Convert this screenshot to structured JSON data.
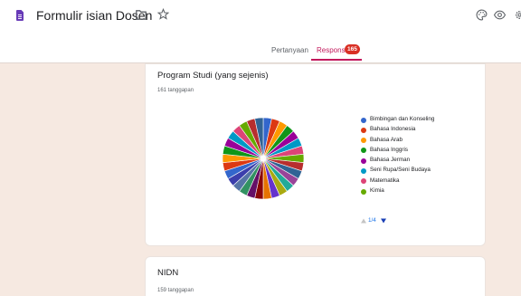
{
  "header": {
    "title": "Formulir isian Dosen"
  },
  "tabs": {
    "questions_label": "Pertanyaan",
    "responses_label": "Respons",
    "responses_count": "165"
  },
  "cards": [
    {
      "title": "Program Studi (yang sejenis)",
      "response_count": "161 tanggapan",
      "chart_data": {
        "type": "pie",
        "legend_position": "right",
        "categories": [
          "Bimbingan dan Konseling",
          "Bahasa Indonesia",
          "Bahasa Arab",
          "Bahasa Inggris",
          "Bahasa Jerman",
          "Seni Rupa/Seni Budaya",
          "Matematika",
          "Kimia"
        ],
        "colors": [
          "#3366cc",
          "#dc3912",
          "#ff9900",
          "#109618",
          "#990099",
          "#0099c6",
          "#dd4477",
          "#66aa00",
          "#b82e2e",
          "#316395",
          "#994499",
          "#22aa99",
          "#aaaa11",
          "#6633cc",
          "#e67300",
          "#8b0707",
          "#651067",
          "#329262",
          "#5574a6",
          "#3b3eac"
        ],
        "slices": 30,
        "pager": "1/4"
      }
    },
    {
      "title": "NIDN",
      "response_count": "159 tanggapan"
    }
  ]
}
